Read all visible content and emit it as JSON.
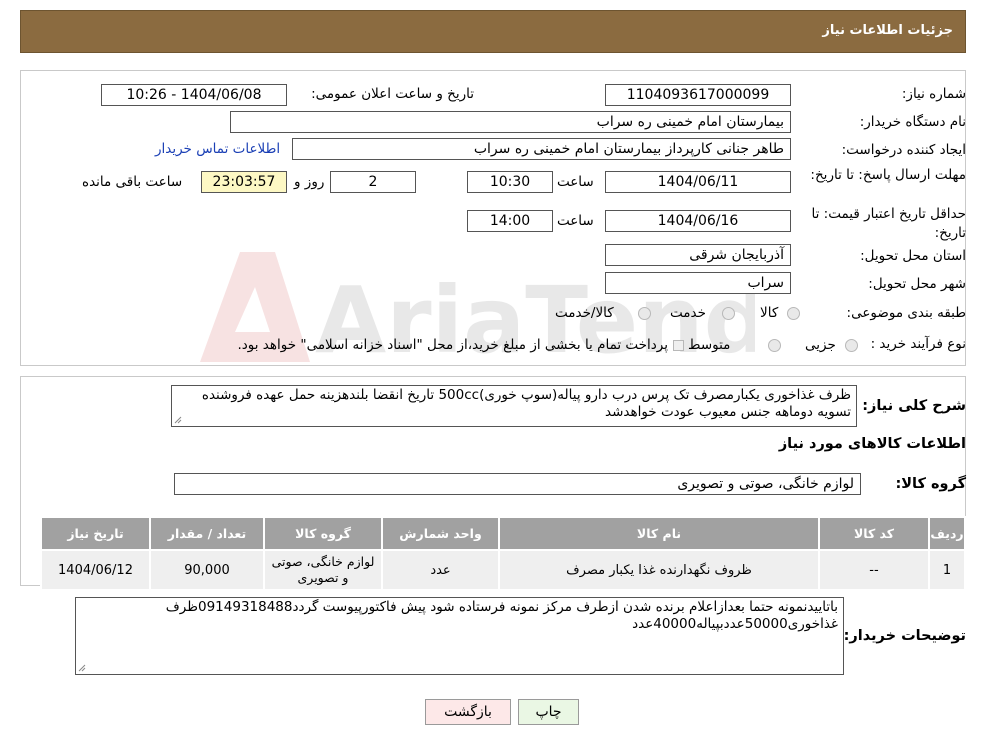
{
  "header": {
    "title": "جزئیات اطلاعات نیاز"
  },
  "form": {
    "need_number_label": "شماره نیاز:",
    "need_number": "1104093617000099",
    "announce_label": "تاریخ و ساعت اعلان عمومی:",
    "announce_value": "1404/06/08 - 10:26",
    "buyer_org_label": "نام دستگاه خریدار:",
    "buyer_org": "بیمارستان امام خمینی ره  سراب",
    "creator_label": "ایجاد کننده درخواست:",
    "creator": "طاهر جنانی کارپرداز بیمارستان امام خمینی ره  سراب",
    "contact_link": "اطلاعات تماس خریدار",
    "deadline_label": "مهلت ارسال پاسخ: تا تاریخ:",
    "deadline_date": "1404/06/11",
    "time_label": "ساعت",
    "deadline_time": "10:30",
    "days_value": "2",
    "days_label": "روز و",
    "remaining_time": "23:03:57",
    "remaining_label": "ساعت باقی مانده",
    "validity_label": "حداقل تاریخ اعتبار قیمت: تا تاریخ:",
    "validity_date": "1404/06/16",
    "validity_time": "14:00",
    "province_label": "استان محل تحویل:",
    "province": "آذربایجان شرقی",
    "city_label": "شهر محل تحویل:",
    "city": "سراب",
    "category_label": "طبقه بندی موضوعی:",
    "category_options": [
      "کالا",
      "خدمت",
      "کالا/خدمت"
    ],
    "process_label": "نوع فرآیند خرید :",
    "process_options": [
      "جزیی",
      "متوسط"
    ],
    "process_note": "پرداخت تمام یا بخشی از مبلغ خرید،از محل \"اسناد خزانه اسلامی\" خواهد بود."
  },
  "description": {
    "label": "شرح کلی نیاز:",
    "text": "ظرف غذاخوری یکبارمصرف تک پرس درب دارو پیاله(سوپ خوری)500cc تاریخ انقضا بلندهزینه حمل عهده فروشنده تسویه دوماهه جنس معیوب عودت خواهدشد"
  },
  "goods": {
    "section_title": "اطلاعات کالاهای مورد نیاز",
    "group_label": "گروه کالا:",
    "group_value": "لوازم خانگی، صوتی و تصویری",
    "columns": [
      "ردیف",
      "کد کالا",
      "نام کالا",
      "واحد شمارش",
      "گروه کالا",
      "تعداد / مقدار",
      "تاریخ نیاز"
    ],
    "rows": [
      {
        "row": "1",
        "code": "--",
        "name": "ظروف نگهدارنده غذا یکبار مصرف",
        "unit": "عدد",
        "group": "لوازم خانگی، صوتی و تصویری",
        "qty": "90,000",
        "date": "1404/06/12"
      }
    ]
  },
  "buyer_notes": {
    "label": "توضیحات خریدار:",
    "text": "باتاییدنمونه حتما بعدازاعلام برنده شدن ازطرف مرکز نمونه فرستاده شود پیش فاکتورپیوست گردد09149318488ظرف غذاخوری50000عددبپیاله40000عدد"
  },
  "buttons": {
    "print": "چاپ",
    "back": "بازگشت"
  },
  "watermark": {
    "text": "AriaTender.neT"
  },
  "colors": {
    "header": "#8b6b40",
    "table_header": "#a1a1a1",
    "link": "#1a3fb5",
    "back_button": "#fde8e8",
    "print_button": "#eaf7e4"
  }
}
